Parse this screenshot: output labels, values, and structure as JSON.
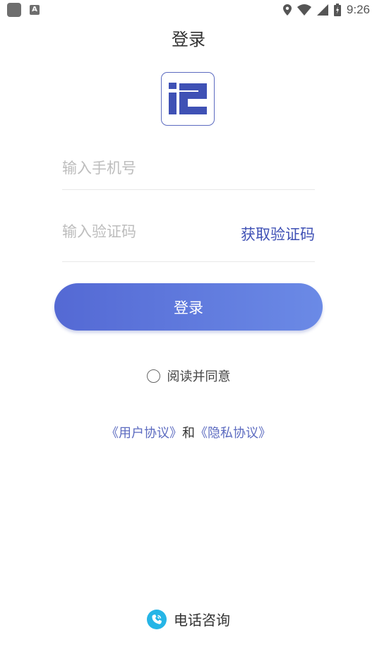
{
  "status_bar": {
    "time": "9:26"
  },
  "header": {
    "title": "登录"
  },
  "form": {
    "phone_placeholder": "输入手机号",
    "code_placeholder": "输入验证码",
    "get_code_label": "获取验证码",
    "login_label": "登录"
  },
  "agreement": {
    "read_agree": "阅读并同意",
    "user_agreement": "《用户协议》",
    "conjunction": "和",
    "privacy_policy": "《隐私协议》"
  },
  "footer": {
    "contact_label": "电话咨询"
  },
  "colors": {
    "accent": "#3f51b5",
    "button_start": "#5469d4",
    "button_end": "#6b8ae6",
    "phone_icon": "#26b5e6"
  }
}
